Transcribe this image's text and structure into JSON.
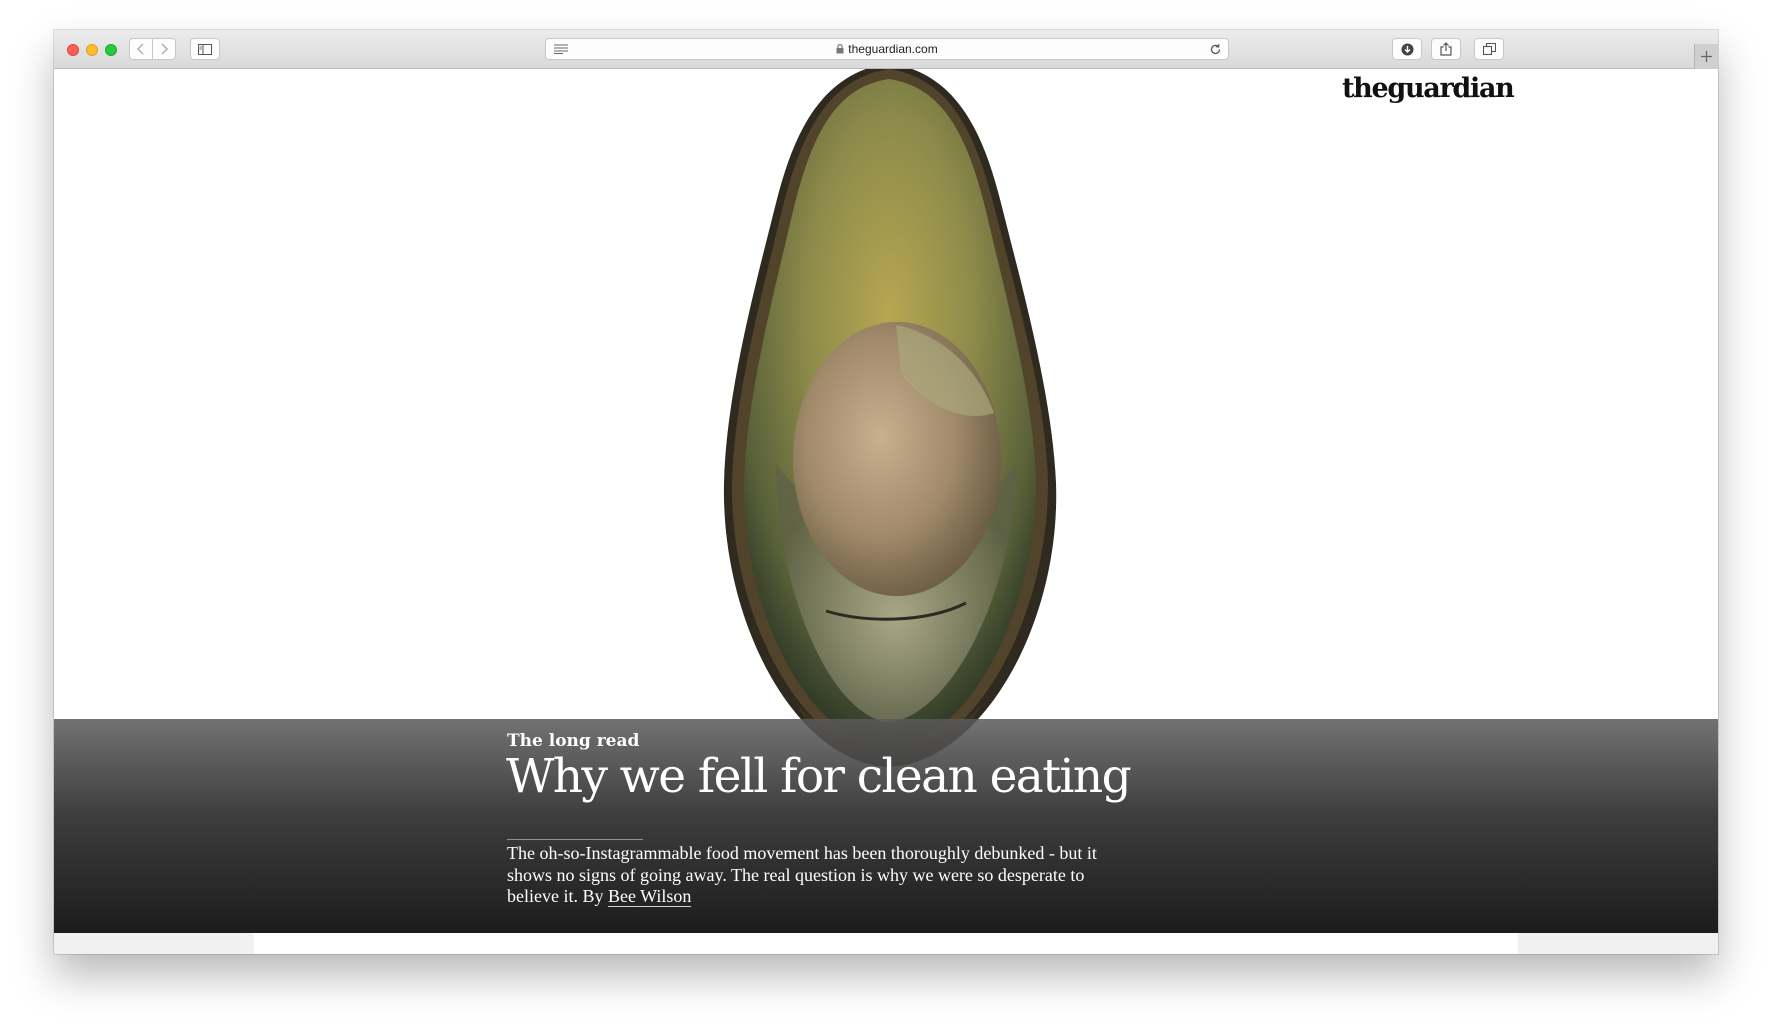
{
  "browser": {
    "url": "theguardian.com",
    "traffic_lights": [
      "close",
      "minimize",
      "zoom"
    ]
  },
  "page": {
    "logo": "theguardian",
    "kicker": "The long read",
    "headline": "Why we fell for clean eating",
    "standfirst": "The oh-so-Instagrammable food movement has been thoroughly debunked - but it shows no signs of going away. The real question is why we were so desperate to believe it. By ",
    "byline": "Bee Wilson"
  }
}
